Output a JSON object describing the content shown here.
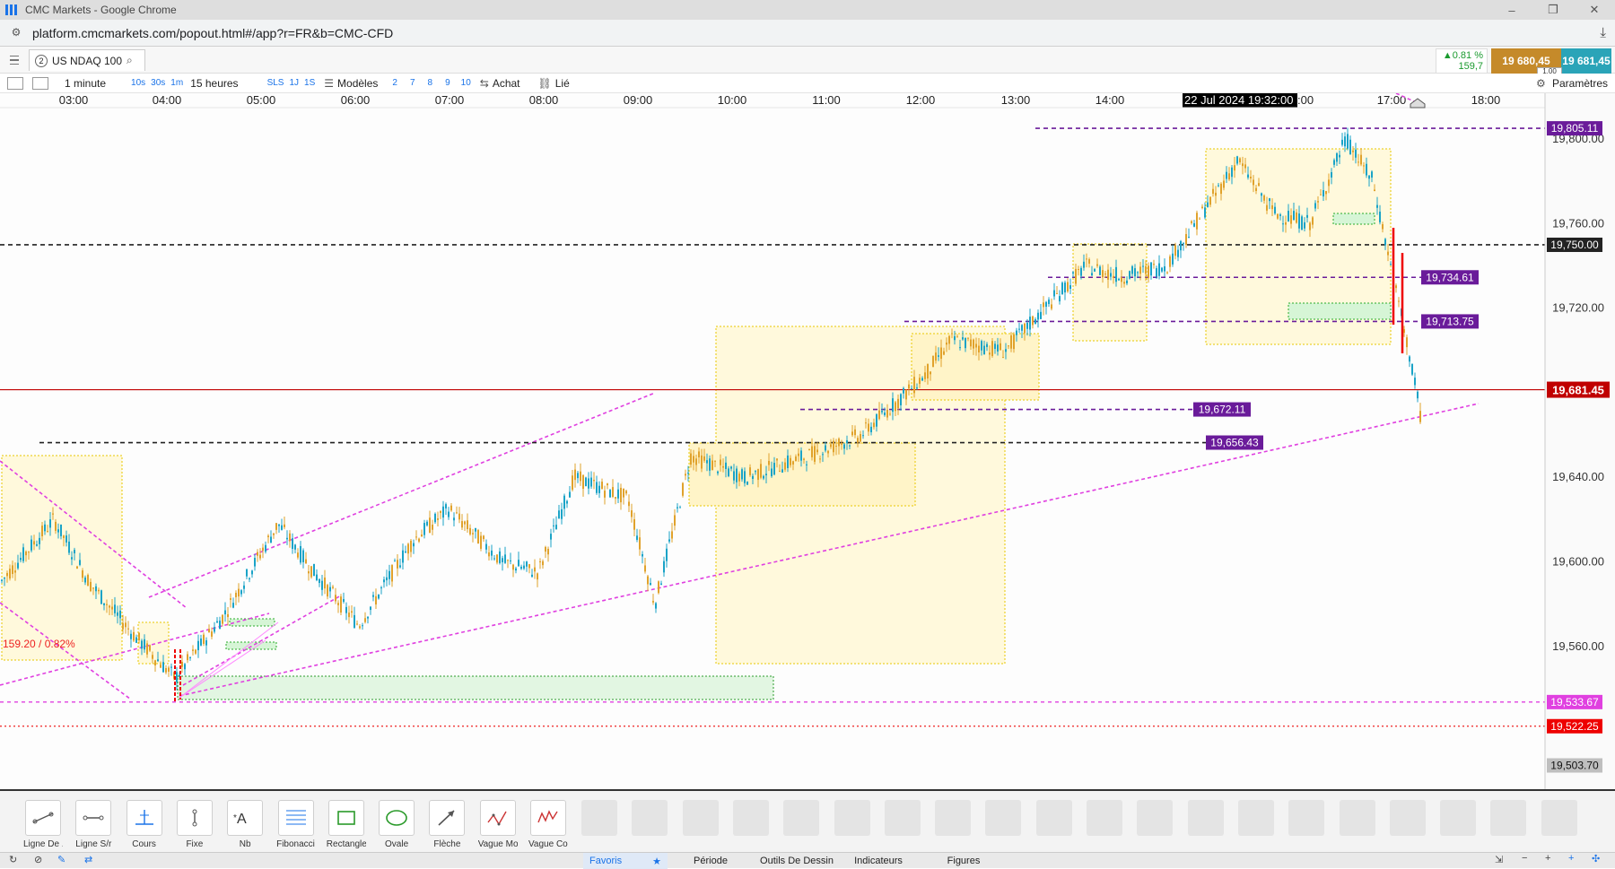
{
  "window": {
    "title": "CMC Markets - Google Chrome",
    "minimize": "–",
    "restore": "❐",
    "close": "✕"
  },
  "browser": {
    "url": "platform.cmcmarkets.com/popout.html#/app?r=FR&b=CMC-CFD",
    "download_icon": "⤓"
  },
  "instrument": {
    "tab_number": "2",
    "name": "US NDAQ 100",
    "change_pct": "▲0.81 %",
    "change_pts": "159,7",
    "sell_price": "19 680,45",
    "buy_price": "19 681,45",
    "spread": "1.00"
  },
  "toolbar": {
    "interval": "1 minute",
    "quick_intervals": [
      "10s",
      "30s",
      "1m"
    ],
    "range": "15 heures",
    "sls": "SLS",
    "range_buttons": [
      "1J",
      "1S"
    ],
    "models": "Modèles",
    "model_numbers": [
      "2",
      "7",
      "8",
      "9",
      "10"
    ],
    "buy": "Achat",
    "linked": "Lié",
    "settings": "Paramètres"
  },
  "chart_data": {
    "type": "candlestick",
    "x_labels": [
      "03:00",
      "04:00",
      "05:00",
      "06:00",
      "07:00",
      "08:00",
      "09:00",
      "10:00",
      "11:00",
      "12:00",
      "13:00",
      "14:00",
      "17:00",
      "18:00"
    ],
    "crosshair_label": "22 Jul 2024 19:32:00",
    "crosshair_suffix": ":00",
    "y_ticks": [
      "19,800.00",
      "19,760.00",
      "19,720.00",
      "19,640.00",
      "19,600.00",
      "19,560.00"
    ],
    "y_range": [
      19495,
      19820
    ],
    "current_price": "19,681.45",
    "price_labels": {
      "p19805": "19,805.11",
      "p19750": "19,750.00",
      "p19734": "19,734.61",
      "p19713": "19,713.75",
      "p19672": "19,672.11",
      "p19656": "19,656.43",
      "p19533": "19,533.67",
      "p19522": "19,522.25",
      "p19503": "19,503.70"
    },
    "change_annotation": "159.20 / 0.82%",
    "colors": {
      "up": "#1aa3c7",
      "down": "#e0a22c",
      "current": "#c00000",
      "trend": "#e040e0",
      "level": "#6a1b9a"
    }
  },
  "tools": [
    {
      "label": "Ligne De ...",
      "icon": "trendline-icon"
    },
    {
      "label": "Ligne S/r",
      "icon": "sr-line-icon"
    },
    {
      "label": "Cours",
      "icon": "price-icon"
    },
    {
      "label": "Fixe",
      "icon": "fixed-icon"
    },
    {
      "label": "Nb",
      "icon": "text-icon"
    },
    {
      "label": "Fibonacci",
      "icon": "fibonacci-icon"
    },
    {
      "label": "Rectangle",
      "icon": "rectangle-icon"
    },
    {
      "label": "Ovale",
      "icon": "oval-icon"
    },
    {
      "label": "Flèche",
      "icon": "arrow-icon"
    },
    {
      "label": "Vague Mo...",
      "icon": "wave-icon"
    },
    {
      "label": "Vague Co...",
      "icon": "wave2-icon"
    }
  ],
  "bottom_tabs": [
    "Favoris",
    "Période",
    "Outils De Dessin",
    "Indicateurs",
    "Figures"
  ]
}
